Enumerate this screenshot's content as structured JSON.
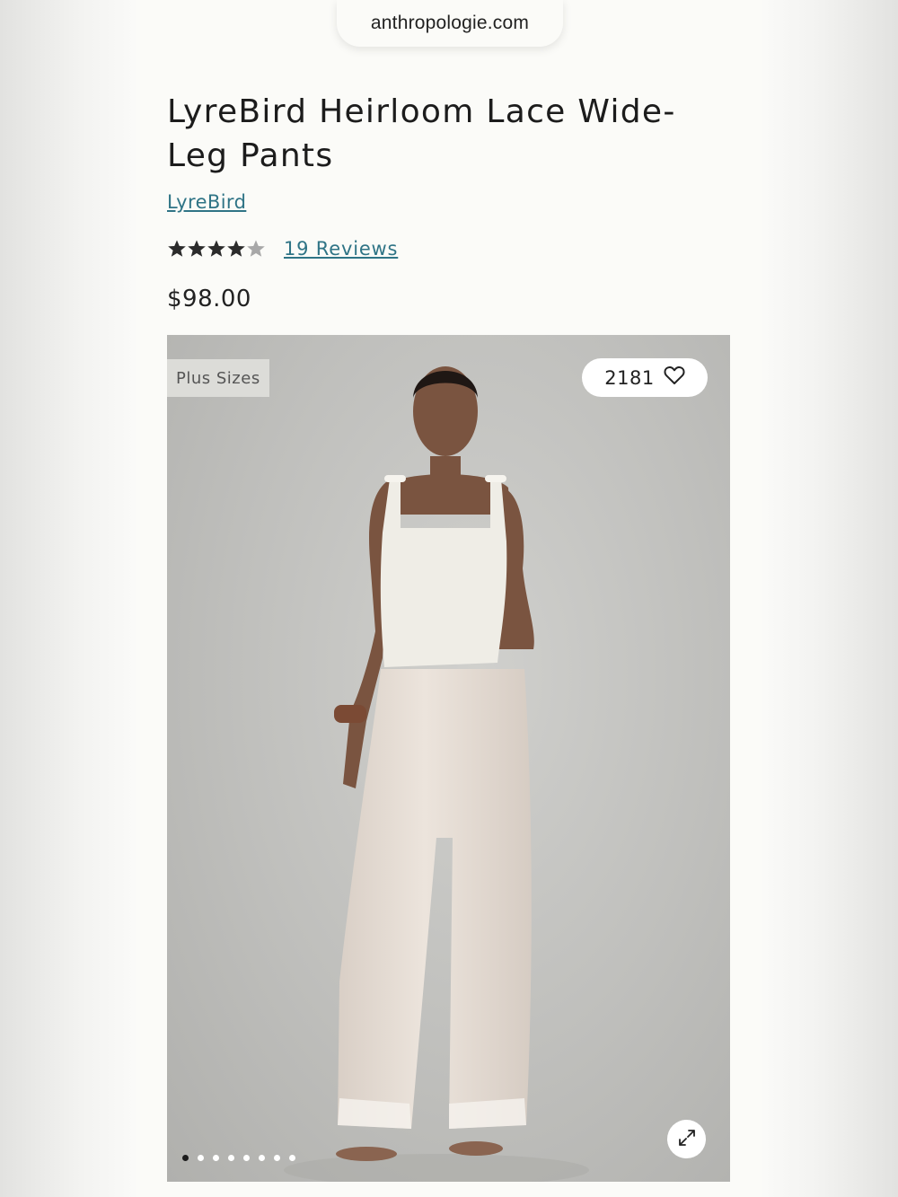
{
  "browser": {
    "url": "anthropologie.com"
  },
  "product": {
    "title": "LyreBird Heirloom Lace Wide-Leg Pants",
    "brand": "LyreBird",
    "rating": 4,
    "rating_max": 5,
    "reviews_label": "19 Reviews",
    "price": "$98.00"
  },
  "gallery": {
    "badge": "Plus Sizes",
    "like_count": "2181",
    "dot_count": 8,
    "active_dot": 0
  },
  "icons": {
    "heart": "heart-icon",
    "expand": "expand-icon",
    "star": "star-icon"
  },
  "colors": {
    "link": "#2f7486",
    "star_filled": "#2b2b2b",
    "star_empty": "#a8a8a8"
  }
}
